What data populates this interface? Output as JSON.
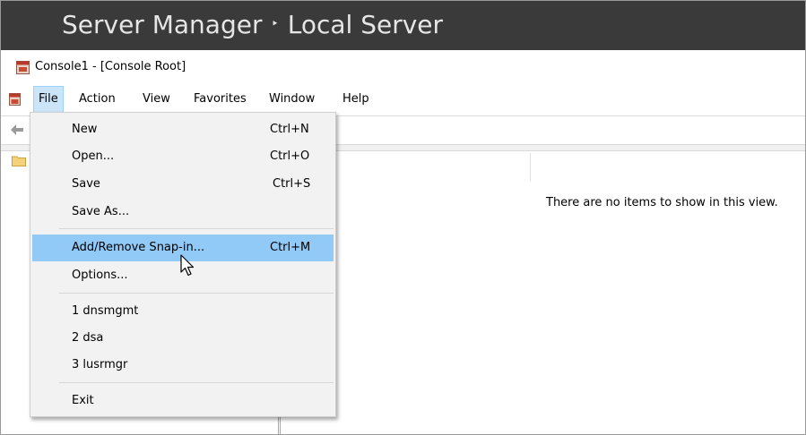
{
  "server_manager": {
    "title_part1": "Server Manager",
    "separator": "‣",
    "title_part2": "Local Server"
  },
  "window": {
    "title": "Console1 - [Console Root]"
  },
  "menu": {
    "items": [
      {
        "label": "File",
        "active": true
      },
      {
        "label": "Action"
      },
      {
        "label": "View"
      },
      {
        "label": "Favorites"
      },
      {
        "label": "Window"
      },
      {
        "label": "Help"
      }
    ]
  },
  "file_menu": {
    "items": [
      {
        "label": "New",
        "shortcut": "Ctrl+N"
      },
      {
        "label": "Open...",
        "shortcut": "Ctrl+O"
      },
      {
        "label": "Save",
        "shortcut": "Ctrl+S"
      },
      {
        "label": "Save As...",
        "shortcut": ""
      },
      {
        "label": "Add/Remove Snap-in...",
        "shortcut": "Ctrl+M",
        "highlighted": true
      },
      {
        "label": "Options...",
        "shortcut": ""
      },
      {
        "label": "1 dnsmgmt",
        "shortcut": ""
      },
      {
        "label": "2 dsa",
        "shortcut": ""
      },
      {
        "label": "3 lusrmgr",
        "shortcut": ""
      },
      {
        "label": "Exit",
        "shortcut": ""
      }
    ]
  },
  "result_pane": {
    "empty_message": "There are no items to show in this view."
  },
  "icons": {
    "app": "mmc-console-icon",
    "back": "back-arrow-icon",
    "tree_root": "folder-icon",
    "pointer": "mouse-cursor-icon"
  },
  "colors": {
    "server_manager_bar": "#3a3a3a",
    "menu_highlight": "#91c9f7",
    "menu_background": "#f2f2f2"
  }
}
